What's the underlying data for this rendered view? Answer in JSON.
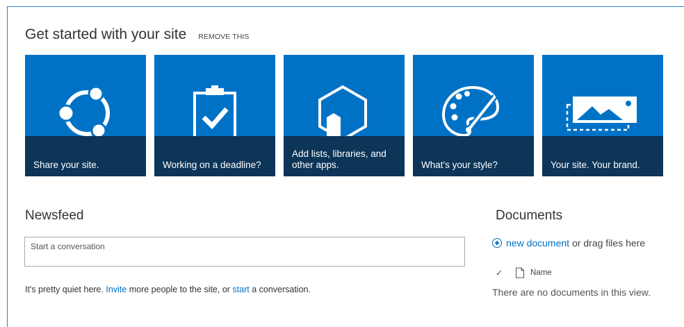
{
  "get_started": {
    "title": "Get started with your site",
    "remove_label": "REMOVE THIS"
  },
  "tiles": [
    {
      "caption": "Share your site.",
      "icon": "share-icon"
    },
    {
      "caption": "Working on a deadline?",
      "icon": "clipboard-check-icon"
    },
    {
      "caption": "Add lists, libraries, and other apps.",
      "icon": "apps-hexagon-icon"
    },
    {
      "caption": "What's your style?",
      "icon": "palette-icon"
    },
    {
      "caption": "Your site. Your brand.",
      "icon": "picture-icon"
    }
  ],
  "colors": {
    "tile_bg": "#0072c6",
    "tile_caption_bg": "#0c3558",
    "link": "#0072c6"
  },
  "newsfeed": {
    "title": "Newsfeed",
    "conversation_placeholder": "Start a conversation",
    "quiet_prefix": "It's pretty quiet here. ",
    "invite_link": "Invite",
    "quiet_middle": " more people to the site, or ",
    "start_link": "start",
    "quiet_suffix": " a conversation."
  },
  "documents": {
    "title": "Documents",
    "new_document_link": "new document",
    "drag_text": "or drag files here",
    "check_symbol": "✓",
    "column_name": "Name",
    "empty_message": "There are no documents in this view."
  }
}
